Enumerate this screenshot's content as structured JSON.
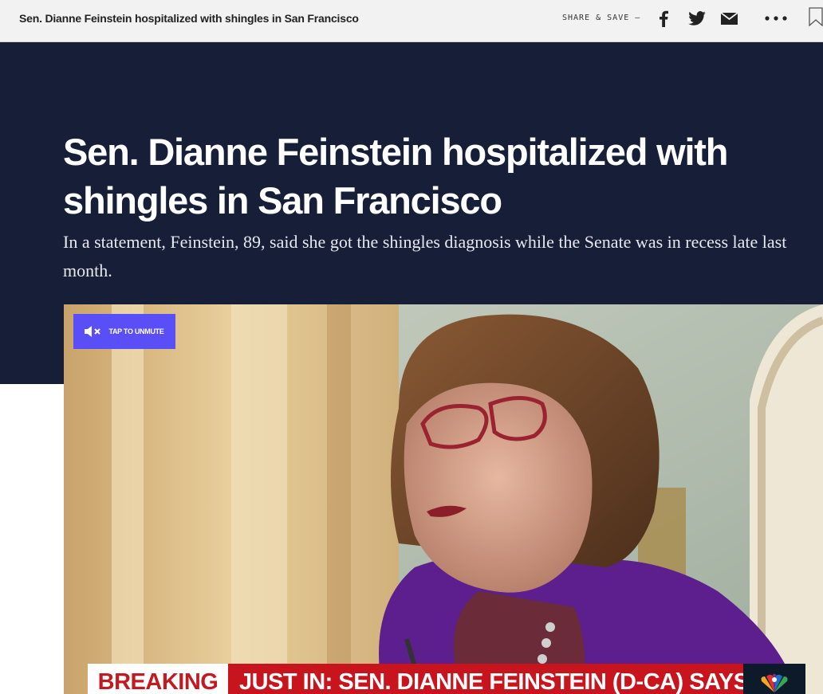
{
  "topbar": {
    "title": "Sen. Dianne Feinstein hospitalized with shingles in San Francisco",
    "share_label": "SHARE & SAVE —",
    "icons": [
      "facebook-icon",
      "twitter-icon",
      "mail-icon",
      "more-icon",
      "bookmark-icon"
    ]
  },
  "article": {
    "headline": "Sen. Dianne Feinstein hospitalized with shingles in San Francisco",
    "dek": "In a statement, Feinstein, 89, said she got the shingles diagnosis while the Senate was in recess late last month."
  },
  "video": {
    "unmute_label": "TAP TO UNMUTE",
    "ticker_label": "BREAKING",
    "ticker_text": "JUST IN: SEN. DIANNE FEINSTEIN (D-CA) SAYS"
  },
  "colors": {
    "hero_bg": "#161e38",
    "unmute_bg": "#5a4ff7",
    "ticker_red": "#c8151d"
  }
}
